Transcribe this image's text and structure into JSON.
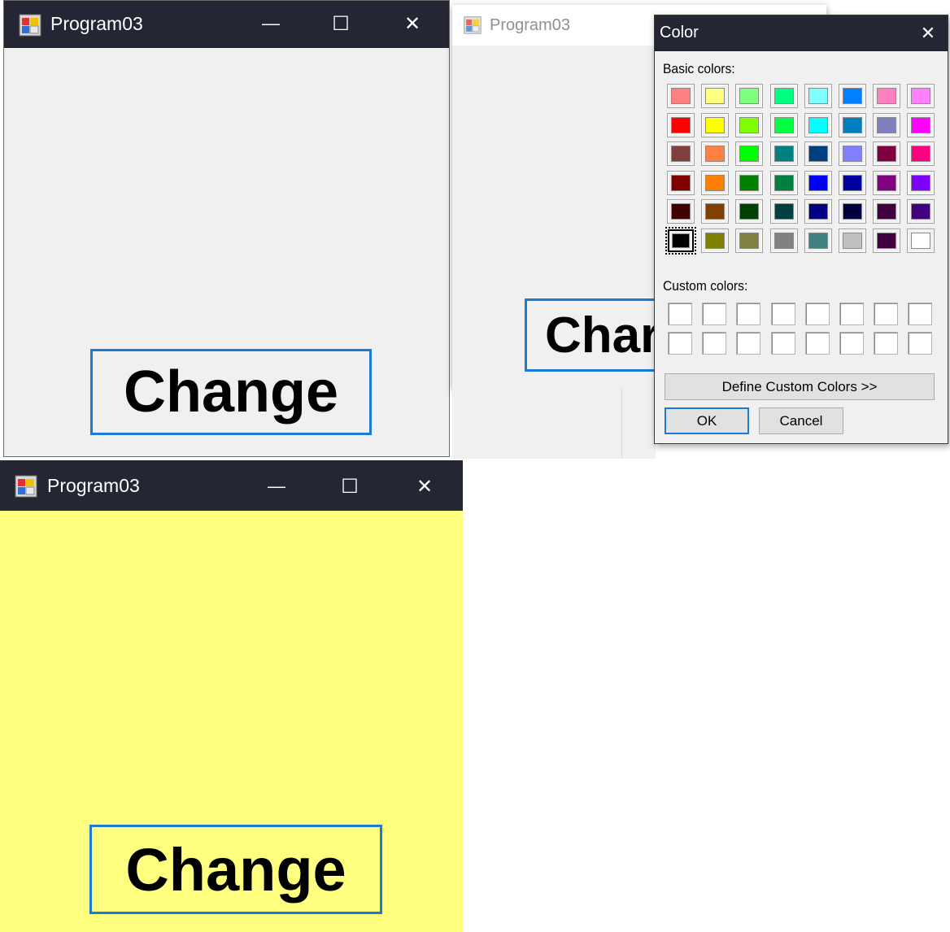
{
  "windows": {
    "top_left": {
      "title": "Program03",
      "button_label": "Change",
      "background_color": "#f0f0f0",
      "controls": {
        "minimize": "—",
        "maximize": "☐",
        "close": "✕"
      }
    },
    "behind_dialog": {
      "title": "Program03",
      "button_label_visible": "Char"
    },
    "bottom_left": {
      "title": "Program03",
      "button_label": "Change",
      "background_color": "#ffff80",
      "controls": {
        "minimize": "—",
        "maximize": "☐",
        "close": "✕"
      }
    }
  },
  "color_dialog": {
    "title": "Color",
    "close_glyph": "✕",
    "basic_colors_label": "Basic colors:",
    "custom_colors_label": "Custom colors:",
    "define_button": "Define Custom Colors >>",
    "ok_button": "OK",
    "cancel_button": "Cancel",
    "selected_index": 40,
    "basic_colors": [
      "#ff8080",
      "#ffff80",
      "#80ff80",
      "#00ff80",
      "#80ffff",
      "#0080ff",
      "#ff80c0",
      "#ff80ff",
      "#ff0000",
      "#ffff00",
      "#80ff00",
      "#00ff40",
      "#00ffff",
      "#0080c0",
      "#8080c0",
      "#ff00ff",
      "#804040",
      "#ff8040",
      "#00ff00",
      "#008080",
      "#004080",
      "#8080ff",
      "#800040",
      "#ff0080",
      "#800000",
      "#ff8000",
      "#008000",
      "#008040",
      "#0000ff",
      "#0000a0",
      "#800080",
      "#8000ff",
      "#400000",
      "#804000",
      "#004000",
      "#004040",
      "#000080",
      "#000040",
      "#400040",
      "#400080",
      "#000000",
      "#808000",
      "#808040",
      "#808080",
      "#408080",
      "#c0c0c0",
      "#400040",
      "#ffffff"
    ],
    "custom_colors": [
      "#ffffff",
      "#ffffff",
      "#ffffff",
      "#ffffff",
      "#ffffff",
      "#ffffff",
      "#ffffff",
      "#ffffff",
      "#ffffff",
      "#ffffff",
      "#ffffff",
      "#ffffff",
      "#ffffff",
      "#ffffff",
      "#ffffff",
      "#ffffff"
    ]
  },
  "colors": {
    "titlebar": "#242633",
    "accent_border": "#1a7ad6"
  }
}
